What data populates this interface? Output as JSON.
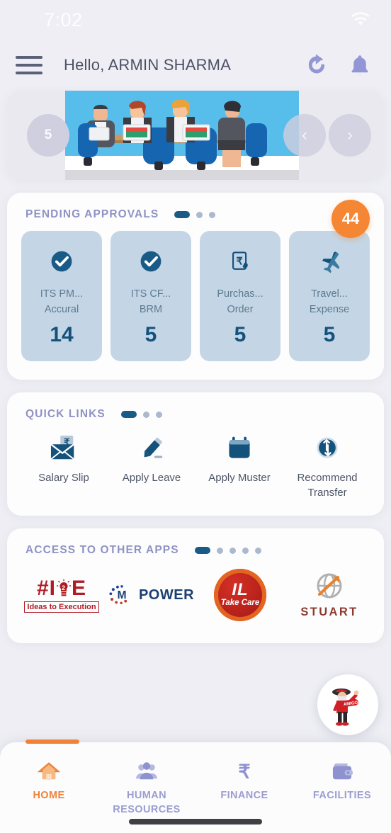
{
  "status_bar": {
    "time": "7:02",
    "wifi_icon": "wifi-icon"
  },
  "header": {
    "menu_icon": "hamburger-menu-icon",
    "greeting": "Hello, ARMIN SHARMA",
    "refresh_icon": "refresh-icon",
    "notifications_icon": "bell-icon"
  },
  "banner": {
    "count_label": "5",
    "prev_label": "‹",
    "next_label": "›",
    "image_alt": "business-meeting-illustration"
  },
  "pending_approvals": {
    "title": "PENDING APPROVALS",
    "badge_count": "44",
    "badge_color": "#f58634",
    "pager": {
      "total": 3,
      "active": 0
    },
    "tiles": [
      {
        "icon": "check-circle-icon",
        "line1": "ITS PM...",
        "line2": "Accural",
        "count": "14"
      },
      {
        "icon": "check-circle-icon",
        "line1": "ITS CF...",
        "line2": "BRM",
        "count": "5"
      },
      {
        "icon": "rupee-document-icon",
        "line1": "Purchas...",
        "line2": "Order",
        "count": "5"
      },
      {
        "icon": "airplane-icon",
        "line1": "Travel...",
        "line2": "Expense",
        "count": "5"
      }
    ]
  },
  "quick_links": {
    "title": "QUICK LINKS",
    "pager": {
      "total": 3,
      "active": 0
    },
    "items": [
      {
        "icon": "salary-envelope-icon",
        "label": "Salary Slip"
      },
      {
        "icon": "pencil-icon",
        "label": "Apply Leave"
      },
      {
        "icon": "calendar-icon",
        "label": "Apply Muster"
      },
      {
        "icon": "transfer-arrows-icon",
        "label": "Recommend Transfer"
      }
    ]
  },
  "other_apps": {
    "title": "ACCESS TO OTHER APPS",
    "pager": {
      "total": 5,
      "active": 0
    },
    "items": [
      {
        "icon": "i2e-logo",
        "name": "#I2E",
        "tagline": "Ideas to Execution",
        "prefix": "#I",
        "suffix": "E"
      },
      {
        "icon": "mpower-logo",
        "name": "M-POWER",
        "m_text": "M",
        "power_text": "POWER"
      },
      {
        "icon": "il-take-care-logo",
        "name": "IL Take Care",
        "il_text": "IL",
        "tc_text": "Take Care"
      },
      {
        "icon": "stuart-logo",
        "name": "STUART",
        "word": "STUART"
      }
    ]
  },
  "fab": {
    "icon": "amigo-mascot-icon",
    "label": "AMIGO"
  },
  "bottom_nav": {
    "active_index": 0,
    "active_color": "#ef8236",
    "inactive_color": "#9a9dd0",
    "items": [
      {
        "icon": "home-icon",
        "label": "HOME"
      },
      {
        "icon": "people-icon",
        "label": "HUMAN RESOURCES"
      },
      {
        "icon": "rupee-icon",
        "label": "FINANCE"
      },
      {
        "icon": "wallet-icon",
        "label": "FACILITIES"
      }
    ]
  }
}
